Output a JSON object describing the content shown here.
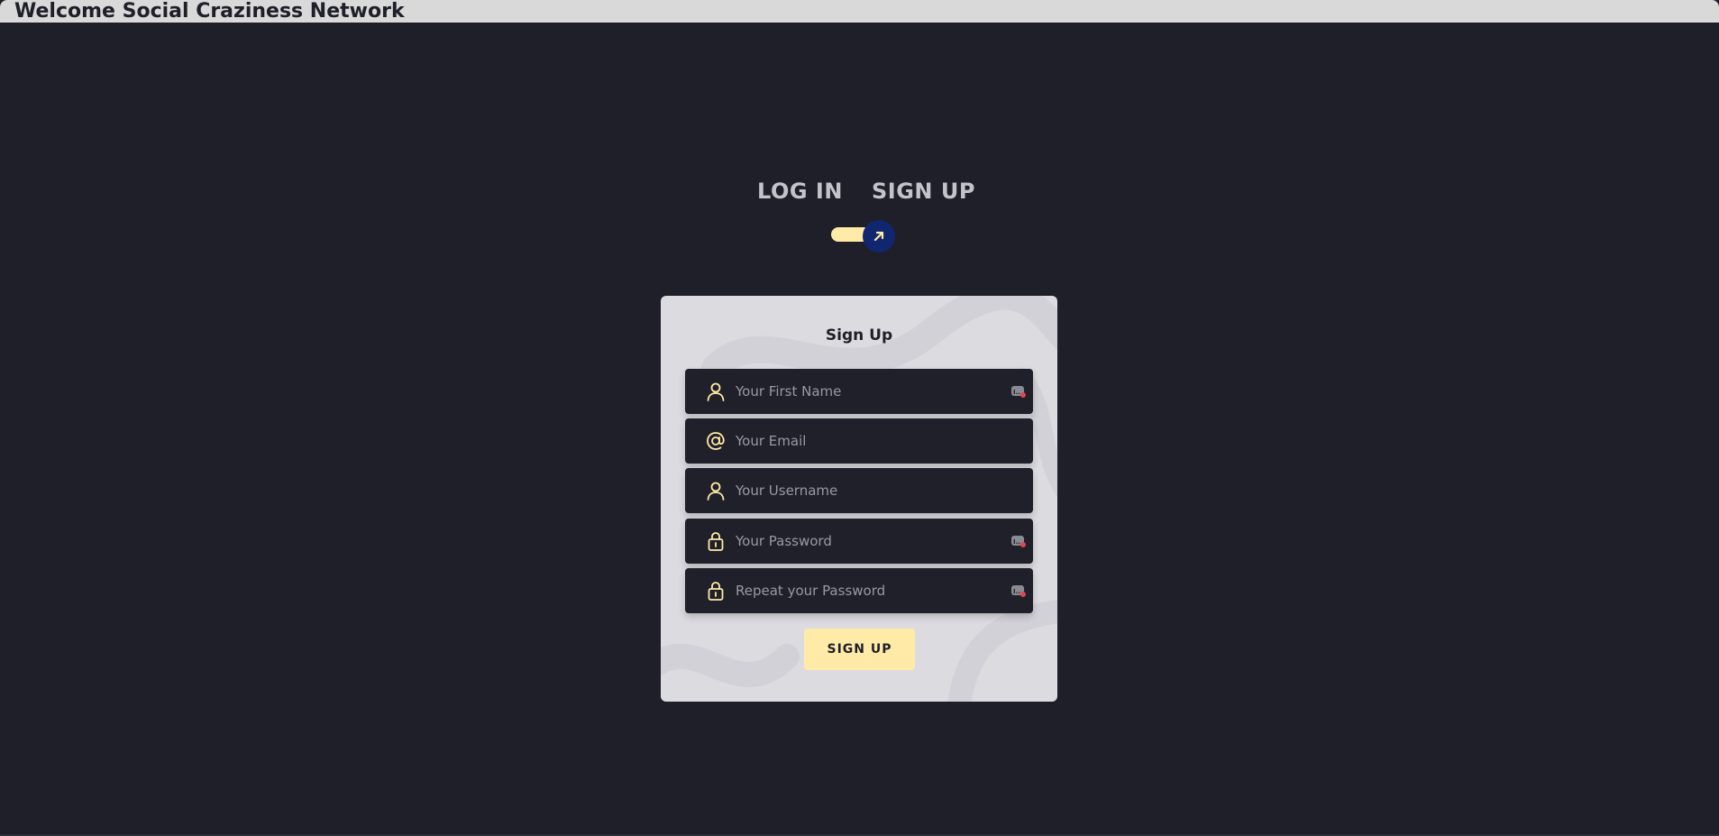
{
  "window": {
    "title": "Welcome Social Craziness Network"
  },
  "toggle": {
    "login_label": "LOG IN",
    "signup_label": "SIGN UP",
    "active": "signup",
    "knob_icon": "arrow-up-right-icon"
  },
  "form": {
    "title": "Sign Up",
    "fields": [
      {
        "placeholder": "Your First Name",
        "icon": "user-icon",
        "autofill_badge": true
      },
      {
        "placeholder": "Your Email",
        "icon": "at-sign-icon",
        "autofill_badge": false
      },
      {
        "placeholder": "Your Username",
        "icon": "user-icon",
        "autofill_badge": false
      },
      {
        "placeholder": "Your Password",
        "icon": "lock-icon",
        "autofill_badge": true
      },
      {
        "placeholder": "Repeat your Password",
        "icon": "lock-icon",
        "autofill_badge": true
      }
    ],
    "submit_label": "SIGN UP"
  },
  "colors": {
    "background": "#1f1f29",
    "accent": "#ffeba7",
    "knob": "#102770",
    "card": "#dcdbe0",
    "field": "#1f2029",
    "label_text": "#c4c3ca"
  }
}
